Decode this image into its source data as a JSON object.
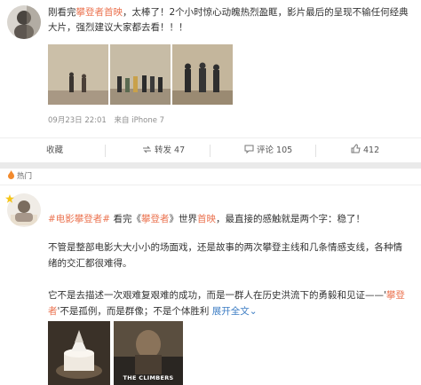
{
  "post1": {
    "text_before": "刚看完",
    "highlight": "攀登者首映",
    "text_after": "，太棒了！2个小时惊心动魄热烈盈眶，影片最后的呈现不输任何经典大片，强烈建议大家都去看！！！",
    "timestamp": "09月23日 22:01",
    "source": "来自 iPhone 7",
    "actions": {
      "favorite": "收藏",
      "repost": "转发 47",
      "comment": "评论 105",
      "like_count": "412"
    }
  },
  "post2": {
    "section_label": "热门",
    "line1": {
      "tag": "#电影攀登者#",
      "mid1": " 看完《",
      "title": "攀登者",
      "mid2": "》世界",
      "premiere": "首映",
      "end": "，最直接的感触就是两个字：稳了！"
    },
    "para2": "不管是整部电影大大小小的场面戏，还是故事的两次攀登主线和几条情感支线，各种情绪的交汇都很难得。",
    "para3": {
      "before": "它不是去描述一次艰难复艰难的成功，而是一群人在历史洪流下的勇毅和见证——'",
      "tag": "攀登者",
      "after": "'不是孤例，而是群像；不是个体胜利",
      "expand": "展开全文",
      "expand_arrow": "⌄"
    },
    "poster_title": "THE CLIMBERS",
    "icons": [
      "avatar-icon",
      "fire-icon",
      "star-icon",
      "share-icon",
      "comment-icon",
      "thumb-up-icon",
      "cake-icon"
    ]
  }
}
